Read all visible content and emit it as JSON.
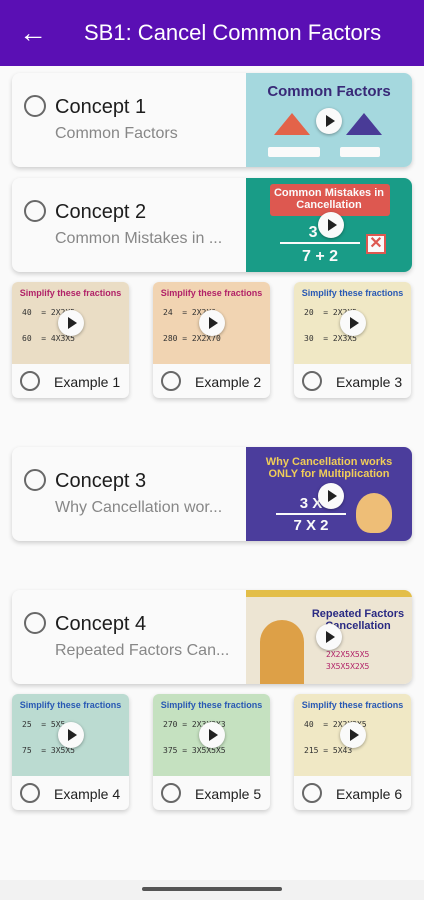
{
  "appbar": {
    "title": "SB1: Cancel Common Factors"
  },
  "concepts": [
    {
      "title": "Concept 1",
      "subtitle": "Common Factors",
      "thumb_text": "Common Factors"
    },
    {
      "title": "Concept 2",
      "subtitle": "Common Mistakes in ...",
      "thumb_text": "Common Mistakes in Cancellation",
      "thumb_eq_top": "3 +",
      "thumb_eq_bottom": "7 + 2"
    },
    {
      "title": "Concept 3",
      "subtitle": "Why Cancellation wor...",
      "thumb_text": "Why Cancellation works ONLY for Multiplication",
      "thumb_eq_top": "3 X",
      "thumb_eq_bottom": "7 X 2"
    },
    {
      "title": "Concept 4",
      "subtitle": "Repeated Factors Can...",
      "thumb_text": "Repeated Factors Cancellation"
    }
  ],
  "examples": [
    {
      "label": "Example 1",
      "thumb_text": "Simplify these fractions"
    },
    {
      "label": "Example 2",
      "thumb_text": "Simplify these fractions"
    },
    {
      "label": "Example 3",
      "thumb_text": "Simplify these fractions"
    },
    {
      "label": "Example 4",
      "thumb_text": "Simplify these fractions"
    },
    {
      "label": "Example 5",
      "thumb_text": "Simplify these fractions"
    },
    {
      "label": "Example 6",
      "thumb_text": "Simplify these fractions"
    }
  ],
  "colors": {
    "appbar": "#5a0fb4",
    "concept1_thumb": "#a9dde3",
    "concept2_thumb": "#1aa08a",
    "concept3_thumb": "#4d3fa0",
    "concept4_thumb": "#f2ead8"
  }
}
